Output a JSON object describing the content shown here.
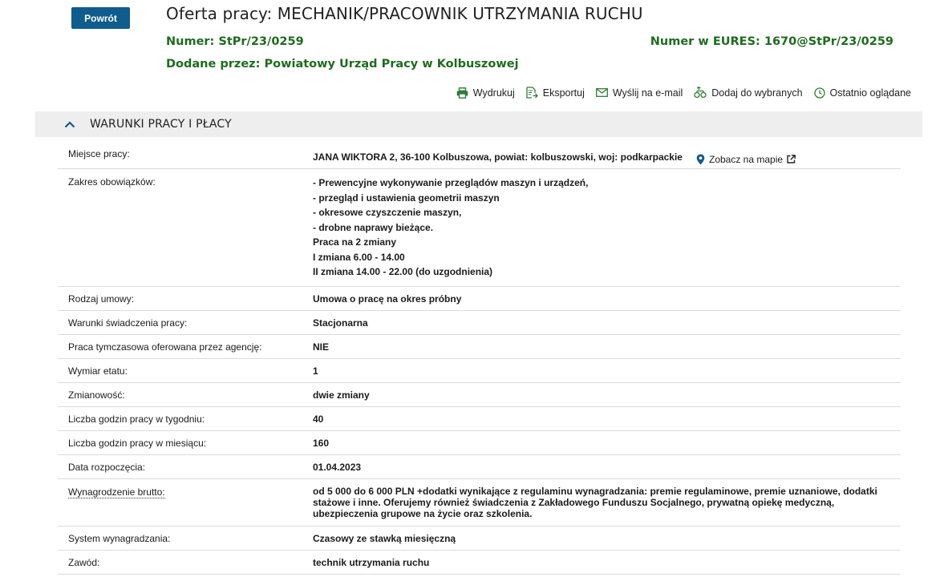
{
  "back_label": "Powrót",
  "title": "Oferta pracy: MECHANIK/PRACOWNIK UTRZYMANIA RUCHU",
  "number": "Numer: StPr/23/0259",
  "eures_number": "Numer w EURES: 1670@StPr/23/0259",
  "added_by_label": "Dodane przez:",
  "added_by_value": "Powiatowy Urząd Pracy w Kolbuszowej",
  "toolbar": {
    "print": "Wydrukuj",
    "export": "Eksportuj",
    "email": "Wyślij na e-mail",
    "favorites": "Dodaj do wybranych",
    "recent": "Ostatnio oglądane"
  },
  "section_title": "WARUNKI PRACY I PŁACY",
  "rows": {
    "place": {
      "label": "Miejsce pracy:",
      "value": "JANA WIKTORA 2, 36-100 Kolbuszowa, powiat: kolbuszowski, woj: podkarpackie",
      "map_link": "Zobacz na mapie"
    },
    "duties": {
      "label": "Zakres obowiązków:",
      "lines": [
        "- Prewencyjne wykonywanie przeglądów maszyn i urządzeń,",
        "- przegląd i ustawienia geometrii maszyn",
        "- okresowe czyszczenie maszyn,",
        "- drobne naprawy bieżące.",
        "Praca na 2 zmiany",
        "I zmiana 6.00 - 14.00",
        "II zmiana 14.00 - 22.00 (do uzgodnienia)"
      ]
    },
    "contract": {
      "label": "Rodzaj umowy:",
      "value": "Umowa o pracę na okres próbny"
    },
    "conditions": {
      "label": "Warunki świadczenia pracy:",
      "value": "Stacjonarna"
    },
    "temporary": {
      "label": "Praca tymczasowa oferowana przez agencję:",
      "value": "NIE"
    },
    "fte": {
      "label": "Wymiar etatu:",
      "value": "1"
    },
    "shifts": {
      "label": "Zmianowość:",
      "value": "dwie zmiany"
    },
    "hours_week": {
      "label": "Liczba godzin pracy w tygodniu:",
      "value": "40"
    },
    "hours_month": {
      "label": "Liczba godzin pracy w miesiącu:",
      "value": "160"
    },
    "start_date": {
      "label": "Data rozpoczęcia:",
      "value": "01.04.2023"
    },
    "salary": {
      "label": "Wynagrodzenie brutto:",
      "value": "od 5 000 do 6 000 PLN +dodatki wynikające z regulaminu wynagradzania: premie regulaminowe, premie uznaniowe, dodatki stażowe i inne. Oferujemy również świadczenia z Zakładowego Funduszu Socjalnego, prywatną opiekę medyczną, ubezpieczenia grupowe na życie oraz szkolenia."
    },
    "pay_system": {
      "label": "System wynagradzania:",
      "value": "Czasowy ze stawką miesięczną"
    },
    "occupation": {
      "label": "Zawód:",
      "value": "technik utrzymania ruchu"
    }
  },
  "colors": {
    "primary_button": "#0f5c8e",
    "green_text": "#1f6b1f",
    "icon_green": "#2e7d32",
    "section_bg": "#eeeeee"
  }
}
